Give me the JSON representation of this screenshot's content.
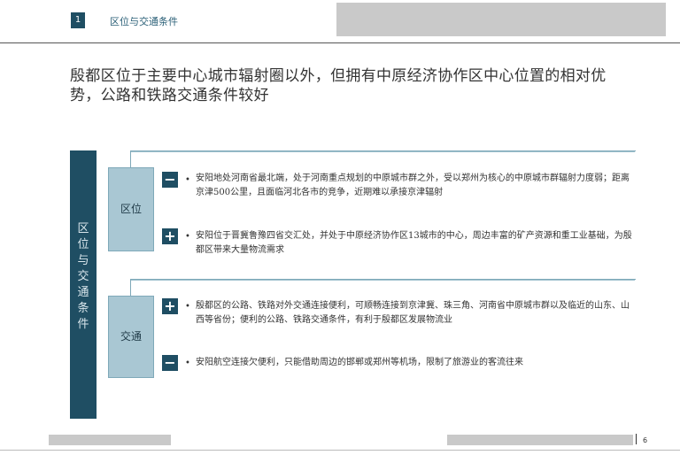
{
  "header": {
    "section_number": "1",
    "section_title": "区位与交通条件"
  },
  "headline": "殷都区位于主要中心城市辐射圈以外，但拥有中原经济协作区中心位置的相对优势，公路和铁路交通条件较好",
  "side_label": "区位与交通条件",
  "sections": [
    {
      "label": "区位",
      "items": [
        {
          "sign": "−",
          "sign_icon": "minus-icon",
          "text": "安阳地处河南省最北端，处于河南重点规划的中原城市群之外，受以郑州为核心的中原城市群辐射力度弱；距离京津500公里，且面临河北各市的竞争，近期难以承接京津辐射"
        },
        {
          "sign": "+",
          "sign_icon": "plus-icon",
          "text": "安阳位于晋冀鲁豫四省交汇处，并处于中原经济协作区13城市的中心，周边丰富的矿产资源和重工业基础，为殷都区带来大量物流需求"
        }
      ]
    },
    {
      "label": "交通",
      "items": [
        {
          "sign": "+",
          "sign_icon": "plus-icon",
          "text": "殷都区的公路、铁路对外交通连接便利，可顺畅连接到京津冀、珠三角、河南省中原城市群以及临近的山东、山西等省份；便利的公路、铁路交通条件，有利于殷都区发展物流业"
        },
        {
          "sign": "−",
          "sign_icon": "minus-icon",
          "text": "安阳航空连接欠便利，只能借助周边的邯郸或郑州等机场，限制了旅游业的客流往来"
        }
      ]
    }
  ],
  "footer": {
    "page_number": "6"
  },
  "colors": {
    "dark_teal": "#1f4e63",
    "light_teal": "#a9c7d3",
    "gray_block": "#c9c9c9"
  }
}
